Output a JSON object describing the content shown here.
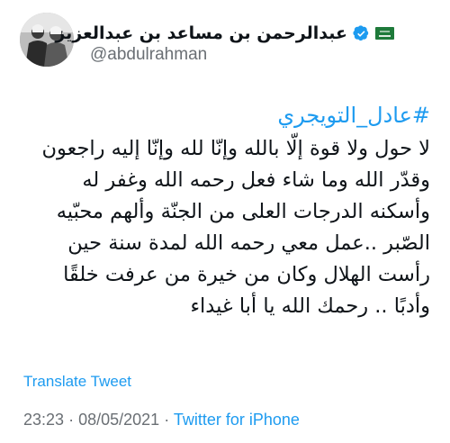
{
  "author": {
    "display_name": "عبدالرحمن بن مساعد بن عبدالعزيز",
    "handle": "@abdulrahman",
    "verified_icon": "verified-badge-icon",
    "flag_icon": "saudi-flag-icon",
    "verified_color": "#1d9bf0",
    "flag_color": "#1e7a3a"
  },
  "tweet": {
    "hashtag": "#عادل_التويجري",
    "lines": [
      "لا حول ولا قوة إلّا بالله وإنّا لله وإنّا إليه راجعون",
      "وقدّر الله وما شاء فعل رحمه الله وغفر له",
      "وأسكنه الدرجات العلى من الجنّة وألهم محبّيه",
      "الصّبر ..عمل معي رحمه الله لمدة سنة حين",
      "رأست الهلال وكان من خيرة من عرفت خلقًا",
      "وأدبًا .. رحمك الله يا أبا غيداء"
    ],
    "translate_label": "Translate Tweet",
    "time": "23:23",
    "date": "08/05/2021",
    "separator": "·",
    "source": "Twitter for iPhone"
  },
  "colors": {
    "link": "#1d9bf0",
    "text": "#0f1419",
    "muted": "#6a6f74"
  }
}
